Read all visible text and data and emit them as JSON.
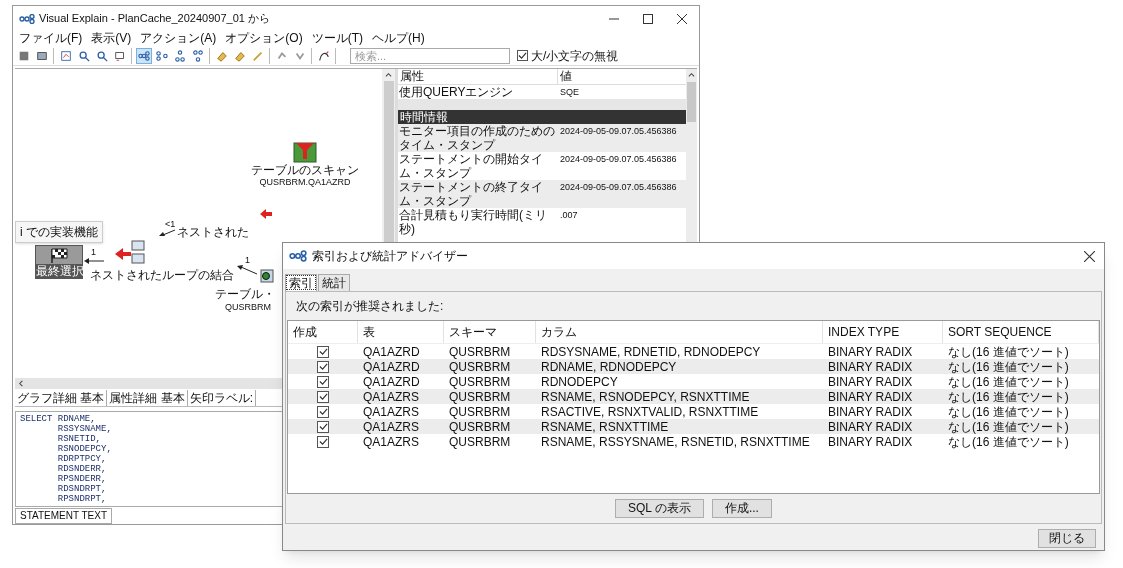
{
  "main_window": {
    "title": "Visual Explain - PlanCache_20240907_01 から",
    "menu": [
      "ファイル(F)",
      "表示(V)",
      "アクション(A)",
      "オプション(O)",
      "ツール(T)",
      "ヘルプ(H)"
    ],
    "toolbar": {
      "groups": [
        [
          {
            "selected": false
          },
          {
            "selected": false
          }
        ],
        [
          {
            "selected": false
          },
          {
            "selected": false
          },
          {
            "selected": false
          },
          {
            "selected": false
          }
        ],
        [
          {
            "selected": true
          },
          {
            "selected": false
          },
          {
            "selected": false
          },
          {
            "selected": false
          }
        ],
        [
          {
            "selected": false
          },
          {
            "selected": false
          },
          {
            "selected": false
          }
        ],
        [
          {
            "selected": false
          },
          {
            "selected": false
          }
        ],
        [
          {
            "selected": false
          }
        ]
      ],
      "search": {
        "placeholder": "検索..."
      },
      "ignore_case": {
        "label": "大/小文字の無視",
        "checked": true
      }
    },
    "diagram": {
      "tooltip": "i での実装機能",
      "scan_node": {
        "label": "テーブルのスキャン",
        "sublabel": "QUSRBRM.QA1AZRD"
      },
      "final_node": {
        "label": "最終選択",
        "edge_label": "1"
      },
      "join_node": {
        "label": "ネストされたループの結合",
        "edge_label": "1"
      },
      "upper_edge": {
        "count": "<1",
        "label": "ネストされた"
      },
      "lower_scan": {
        "label": "テーブル・",
        "sublabel": "QUSRBRM"
      }
    },
    "properties": {
      "columns": [
        "属性",
        "値"
      ],
      "rows": [
        {
          "kind": "row",
          "name": "使用QUERYエンジン",
          "value": "SQE"
        },
        {
          "kind": "blank"
        },
        {
          "kind": "section",
          "name": "時間情報"
        },
        {
          "kind": "row",
          "name": "モニター項目の作成のためのタイム・スタンプ",
          "value": "2024-09-05-09.07.05.456386"
        },
        {
          "kind": "row",
          "name": "ステートメントの開始タイム・スタンプ",
          "value": "2024-09-05-09.07.05.456386"
        },
        {
          "kind": "row",
          "name": "ステートメントの終了タイム・スタンプ",
          "value": "2024-09-05-09.07.05.456386"
        },
        {
          "kind": "row",
          "name": "合計見積もり実行時間(ミリ秒)",
          "value": ".007"
        }
      ]
    },
    "view_tabs": [
      "グラフ詳細 基本",
      "属性詳細 基本",
      "矢印ラベル:"
    ],
    "sql_text": [
      "SELECT RDNAME,",
      "       RSSYSNAME,",
      "       RSNETID,",
      "       RSNODEPCY,",
      "       RDRPTPCY,",
      "       RDSNDERR,",
      "       RPSNDERR,",
      "       RDSNDRPT,",
      "       RPSNDRPT,"
    ],
    "bottom_tab": "STATEMENT TEXT"
  },
  "dialog": {
    "title": "索引および統計アドバイザー",
    "tabs": [
      {
        "label": "索引",
        "selected": true
      },
      {
        "label": "統計",
        "selected": false
      }
    ],
    "message": "次の索引が推奨されました:",
    "columns": [
      "作成",
      "表",
      "スキーマ",
      "カラム",
      "INDEX TYPE",
      "SORT SEQUENCE"
    ],
    "rows": [
      {
        "checked": true,
        "table": "QA1AZRD",
        "schema": "QUSRBRM",
        "columns": "RDSYSNAME, RDNETID, RDNODEPCY",
        "index_type": "BINARY RADIX",
        "sort_sequence": "なし(16 進値でソート)"
      },
      {
        "checked": true,
        "table": "QA1AZRD",
        "schema": "QUSRBRM",
        "columns": "RDNAME, RDNODEPCY",
        "index_type": "BINARY RADIX",
        "sort_sequence": "なし(16 進値でソート)"
      },
      {
        "checked": true,
        "table": "QA1AZRD",
        "schema": "QUSRBRM",
        "columns": "RDNODEPCY",
        "index_type": "BINARY RADIX",
        "sort_sequence": "なし(16 進値でソート)"
      },
      {
        "checked": true,
        "table": "QA1AZRS",
        "schema": "QUSRBRM",
        "columns": "RSNAME, RSNODEPCY, RSNXTTIME",
        "index_type": "BINARY RADIX",
        "sort_sequence": "なし(16 進値でソート)"
      },
      {
        "checked": true,
        "table": "QA1AZRS",
        "schema": "QUSRBRM",
        "columns": "RSACTIVE, RSNXTVALID, RSNXTTIME",
        "index_type": "BINARY RADIX",
        "sort_sequence": "なし(16 進値でソート)"
      },
      {
        "checked": true,
        "table": "QA1AZRS",
        "schema": "QUSRBRM",
        "columns": "RSNAME, RSNXTTIME",
        "index_type": "BINARY RADIX",
        "sort_sequence": "なし(16 進値でソート)"
      },
      {
        "checked": true,
        "table": "QA1AZRS",
        "schema": "QUSRBRM",
        "columns": "RSNAME, RSSYSNAME, RSNETID, RSNXTTIME",
        "index_type": "BINARY RADIX",
        "sort_sequence": "なし(16 進値でソート)"
      }
    ],
    "buttons": [
      "SQL の表示",
      "作成..."
    ],
    "close_button": "閉じる"
  }
}
